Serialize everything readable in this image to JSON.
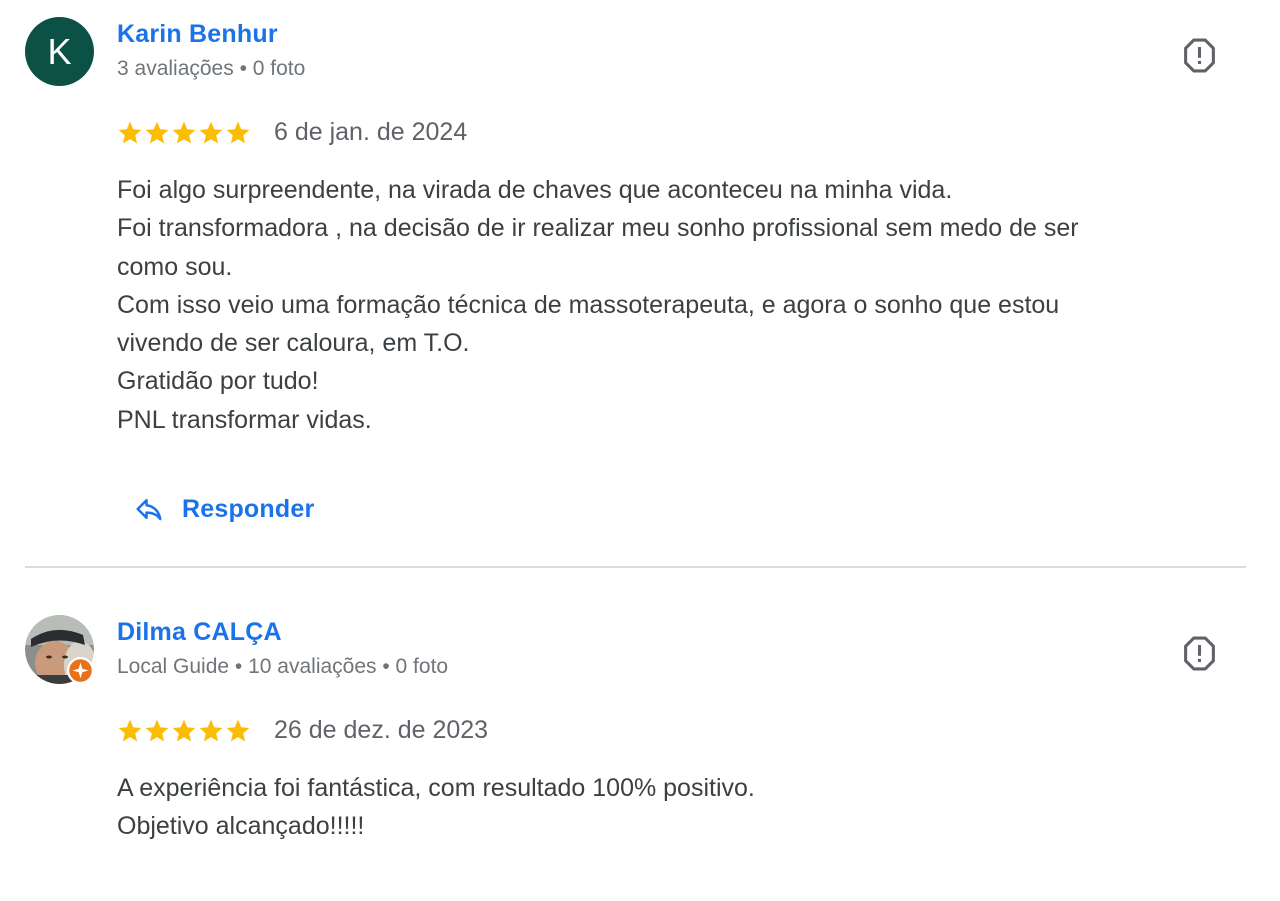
{
  "reviews": [
    {
      "avatar_letter": "K",
      "avatar_color": "#0c5146",
      "name": "Karin Benhur",
      "meta": "3 avaliações • 0 foto",
      "rating": 5,
      "date": "6 de jan. de 2024",
      "lines": [
        "Foi algo surpreendente, na virada de chaves que aconteceu na minha vida.",
        "Foi transformadora , na decisão de ir realizar meu sonho profissional sem medo de ser",
        "como sou.",
        "Com isso veio uma formação técnica de massoterapeuta, e agora o sonho que estou",
        "vivendo de ser caloura, em T.O.",
        "Gratidão por tudo!",
        "PNL transformar vidas."
      ],
      "reply_label": "Responder",
      "report_icon": "report-flag-icon"
    },
    {
      "avatar_type": "photo",
      "name": "Dilma CALÇA",
      "meta": "Local Guide • 10 avaliações • 0 foto",
      "rating": 5,
      "date": "26 de dez. de 2023",
      "lines": [
        "A experiência foi fantástica, com resultado 100% positivo.",
        "Objetivo alcançado!!!!!"
      ],
      "report_icon": "report-flag-icon"
    }
  ],
  "colors": {
    "link_blue": "#1a73e8",
    "star_gold": "#fbbc04",
    "meta_gray": "#70757a",
    "text": "#3c4043",
    "local_guide_orange": "#e8711a"
  }
}
